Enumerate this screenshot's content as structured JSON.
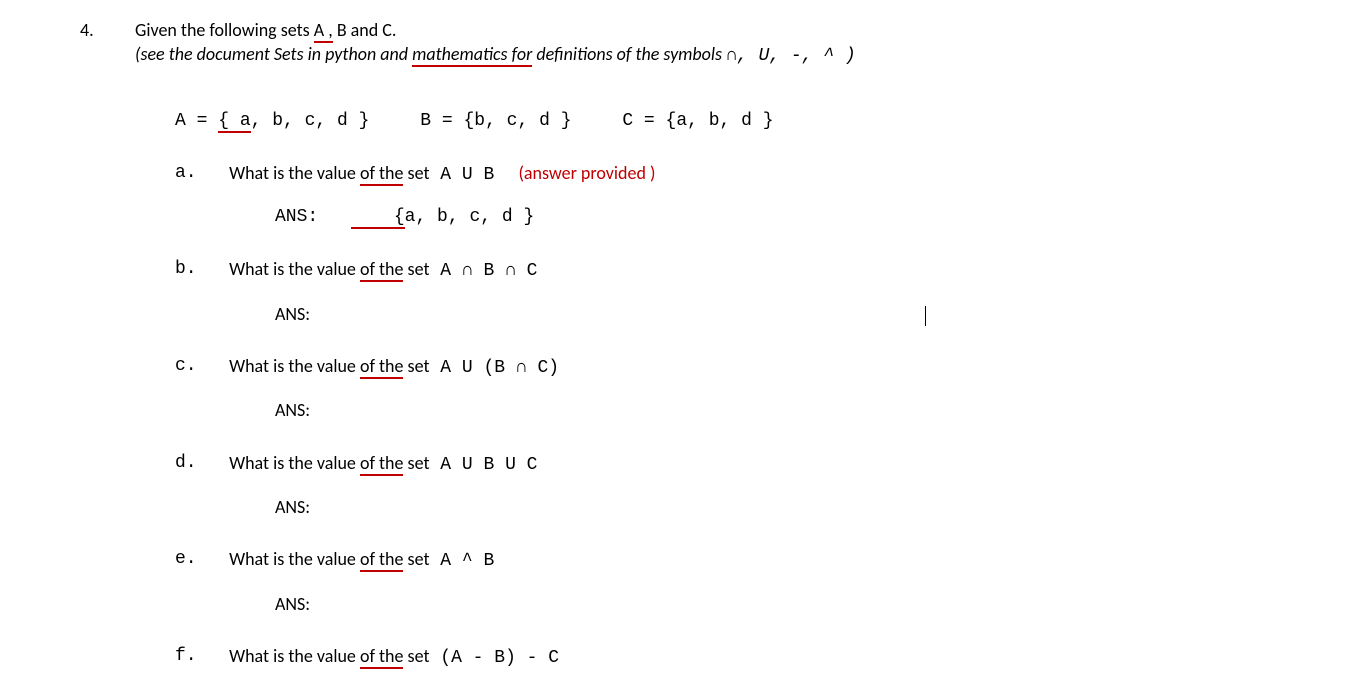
{
  "qnum": "4.",
  "intro1a": "Given the following sets ",
  "intro1b": "A ,",
  "intro1c": " B and C.",
  "intro2a": "(see the document Sets in python and ",
  "intro2b": "mathematics  for",
  "intro2c": " definitions of the symbols ",
  "intro2d": "∩,  U,  -,  ^ )",
  "setA_pre": "A = ",
  "setA_u": "{ a",
  "setA_post": ", b, c, d }",
  "setB": "B =  {b, c, d }",
  "setC": "C = {a, b, d }",
  "q": {
    "a": {
      "lbl": "a.",
      "t1": "What is the value ",
      "t2": "of  the",
      "t3": " set",
      "expr": "  A U B",
      "note": "(answer provided )",
      "ans_lbl": "ANS:",
      "ans_u": "    {",
      "ans_post": "a, b, c, d }"
    },
    "b": {
      "lbl": "b.",
      "t1": "What is the value ",
      "t2": "of  the",
      "t3": " set",
      "expr": "  A ∩ B ∩ C",
      "ans_lbl": "ANS:"
    },
    "c": {
      "lbl": "c.",
      "t1": "What is the value ",
      "t2": "of  the",
      "t3": " set",
      "expr": "  A U  (B  ∩  C)",
      "ans_lbl": "ANS:"
    },
    "d": {
      "lbl": "d.",
      "t1": "What is the value ",
      "t2": "of  the",
      "t3": " set",
      "expr": "  A U B U C",
      "ans_lbl": "ANS:"
    },
    "e": {
      "lbl": "e.",
      "t1": "What is the value ",
      "t2": "of  the",
      "t3": " set",
      "expr": "  A ^ B",
      "ans_lbl": "ANS:"
    },
    "f": {
      "lbl": "f.",
      "t1": "What is the value ",
      "t2": "of  the",
      "t3": " set",
      "expr": " (A  -  B)  -  C"
    }
  }
}
